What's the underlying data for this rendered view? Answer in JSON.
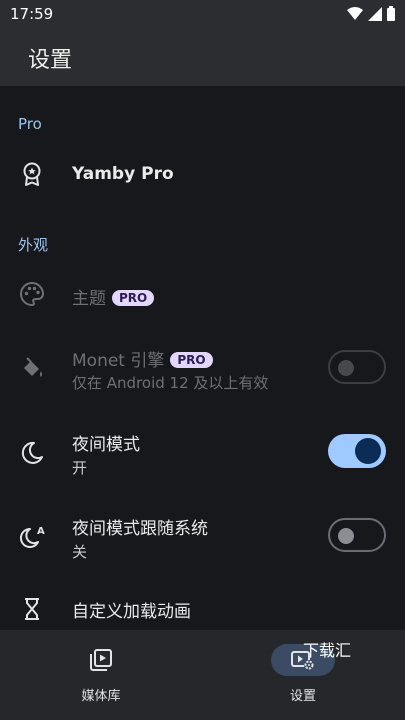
{
  "status_bar": {
    "time": "17:59"
  },
  "app_bar": {
    "title": "设置"
  },
  "sections": {
    "pro": {
      "header": "Pro"
    },
    "appearance": {
      "header": "外观"
    }
  },
  "settings": {
    "yamby_pro": {
      "title": "Yamby Pro"
    },
    "theme": {
      "title": "主题",
      "badge": "PRO"
    },
    "monet": {
      "title": "Monet 引擎",
      "badge": "PRO",
      "subtitle": "仅在 Android 12 及以上有效",
      "enabled": false,
      "toggle": "off"
    },
    "night_mode": {
      "title": "夜间模式",
      "subtitle": "开",
      "toggle": "on"
    },
    "night_follow_system": {
      "title": "夜间模式跟随系统",
      "subtitle": "关",
      "toggle": "off"
    },
    "custom_loading": {
      "title": "自定义加载动画"
    }
  },
  "bottom_nav": {
    "items": [
      {
        "label": "媒体库",
        "icon": "media-library-icon",
        "active": false
      },
      {
        "label": "设置",
        "icon": "settings-icon",
        "active": true
      }
    ]
  },
  "watermark": "下载汇",
  "colors": {
    "accent": "#9fcaff",
    "background": "#17181c",
    "section_header": "#9cc3ef",
    "badge": "#e9ddff"
  }
}
